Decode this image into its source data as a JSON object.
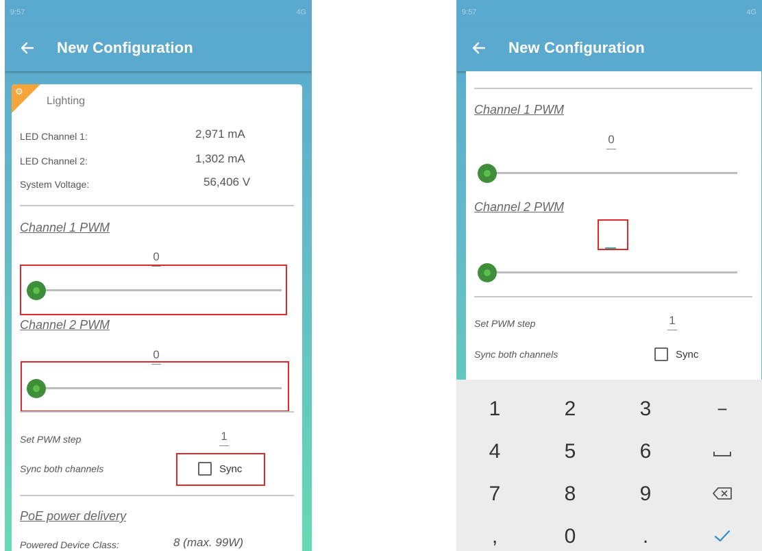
{
  "status_bar": {
    "time": "9:57",
    "network": "4G"
  },
  "app_bar": {
    "title": "New Configuration"
  },
  "left": {
    "section_title": "Lighting",
    "readings": [
      {
        "label": "LED Channel 1:",
        "value": "2,971 mA"
      },
      {
        "label": "LED Channel 2:",
        "value": "1,302 mA"
      },
      {
        "label": "System Voltage:",
        "value": "56,406 V"
      }
    ],
    "channel1": {
      "title": "Channel 1 PWM",
      "value": "0",
      "slider_level": 0
    },
    "channel2": {
      "title": "Channel 2 PWM",
      "value": "0",
      "slider_level": 0
    },
    "pwm_step": {
      "label": "Set PWM step",
      "value": "1"
    },
    "sync": {
      "label": "Sync both channels",
      "checkbox_label": "Sync",
      "checked": false
    },
    "poe": {
      "title": "PoE power delivery",
      "label": "Powered Device Class:",
      "value": "8 (max. 99W)"
    }
  },
  "right": {
    "channel1": {
      "title": "Channel 1 PWM",
      "value": "0",
      "slider_level": 0
    },
    "channel2": {
      "title": "Channel 2 PWM",
      "value": "",
      "slider_level": 0
    },
    "pwm_step": {
      "label": "Set PWM step",
      "value": "1"
    },
    "sync": {
      "label": "Sync both channels",
      "checkbox_label": "Sync",
      "checked": false
    }
  },
  "keyboard": {
    "row1": [
      "1",
      "2",
      "3",
      "−"
    ],
    "row2": [
      "4",
      "5",
      "6",
      "space-icon"
    ],
    "row3": [
      "7",
      "8",
      "9",
      "backspace-icon"
    ],
    "row4": [
      ",",
      "0",
      ".",
      "check-icon"
    ]
  },
  "colors": {
    "app_bar": "#5ba9cf",
    "accent_orange": "#f5a53a",
    "slider_thumb": "#3e8e3a",
    "highlight_box": "#e0282a",
    "cursor": "#2ab0b0",
    "confirm": "#2a8fd4"
  }
}
